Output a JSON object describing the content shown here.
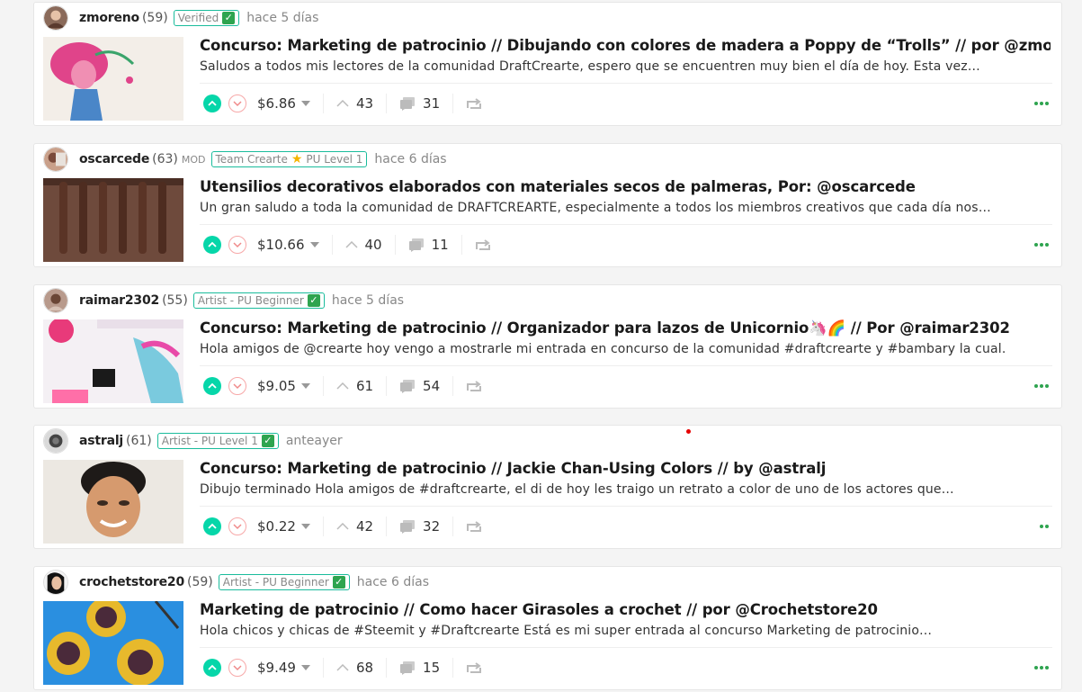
{
  "posts": [
    {
      "author": "zmoreno",
      "reputation": "(59)",
      "mod": "",
      "badge": "Verified",
      "badge_star": false,
      "badge_tail": "",
      "time": "hace 5 días",
      "title": "Concurso: Marketing de patrocinio // Dibujando con colores de madera a Poppy de “Trolls” // por @zmoreno",
      "excerpt": "Saludos a todos mis lectores de la comunidad DraftCrearte, espero que se encuentren muy bien el día de hoy. Esta vez…",
      "payout": "$6.86",
      "votes": "43",
      "comments": "31"
    },
    {
      "author": "oscarcede",
      "reputation": "(63)",
      "mod": "MOD",
      "badge": "Team Crearte",
      "badge_star": true,
      "badge_tail": "PU Level 1",
      "time": "hace 6 días",
      "title": "Utensilios decorativos elaborados con materiales secos de palmeras, Por: @oscarcede",
      "excerpt": "Un gran saludo a toda la comunidad de DRAFTCREARTE, especialmente a todos los miembros creativos que cada día nos…",
      "payout": "$10.66",
      "votes": "40",
      "comments": "11"
    },
    {
      "author": "raimar2302",
      "reputation": "(55)",
      "mod": "",
      "badge": "Artist - PU Beginner",
      "badge_star": false,
      "badge_tail": "",
      "time": "hace 5 días",
      "title": "Concurso: Marketing de patrocinio // Organizador para lazos de Unicornio🦄🌈 // Por @raimar2302",
      "excerpt": "Hola amigos de @crearte hoy vengo a mostrarle mi entrada en concurso de la comunidad #draftcrearte y #bambary la cual…",
      "payout": "$9.05",
      "votes": "61",
      "comments": "54"
    },
    {
      "author": "astralj",
      "reputation": "(61)",
      "mod": "",
      "badge": "Artist - PU Level 1",
      "badge_star": false,
      "badge_tail": "",
      "time": "anteayer",
      "title": "Concurso: Marketing de patrocinio // Jackie Chan-Using Colors // by @astralj",
      "excerpt": "Dibujo terminado Hola amigos de #draftcrearte, el di de hoy les traigo un retrato a color de uno de los actores que…",
      "payout": "$0.22",
      "votes": "42",
      "comments": "32"
    },
    {
      "author": "crochetstore20",
      "reputation": "(59)",
      "mod": "",
      "badge": "Artist - PU Beginner",
      "badge_star": false,
      "badge_tail": "",
      "time": "hace 6 días",
      "title": "Marketing de patrocinio // Como hacer Girasoles a crochet // por @Crochetstore20",
      "excerpt": "Hola chicos y chicas de #Steemit y #Draftcrearte Está es mi super entrada al concurso Marketing de patrocinio…",
      "payout": "$9.49",
      "votes": "68",
      "comments": "15"
    }
  ],
  "icons": {
    "upvote": "chevron-up-circle-icon",
    "downvote": "chevron-down-circle-icon",
    "votes": "caret-up-icon",
    "comments": "comment-bubble-icon",
    "reblog": "reblog-icon",
    "more": "ellipsis-icon",
    "verified": "checkmark-icon",
    "star": "star-icon"
  },
  "colors": {
    "upvote": "#06d6a9",
    "downvote_border": "#f7a8a8",
    "badge_border": "#1abc9c",
    "verified_check": "#2ea44f",
    "more_dots": "#2ea44f"
  }
}
